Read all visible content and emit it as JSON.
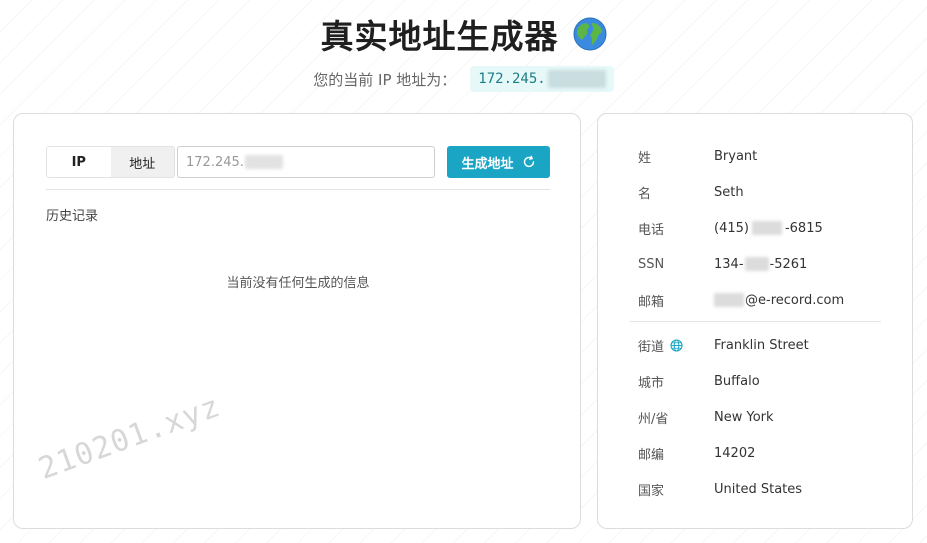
{
  "header": {
    "title": "真实地址生成器",
    "globe_icon": "globe-icon",
    "ip_label": "您的当前 IP 地址为：",
    "ip_prefix": "172.245."
  },
  "form": {
    "tab_ip": "IP",
    "tab_address": "地址",
    "ip_input_value": "172.245.",
    "generate_button": "生成地址",
    "refresh_icon": "refresh-icon",
    "history_label": "历史记录",
    "empty_message": "当前没有任何生成的信息",
    "watermark": "210201.xyz"
  },
  "info": {
    "last_name_label": "姓",
    "last_name": "Bryant",
    "first_name_label": "名",
    "first_name": "Seth",
    "phone_label": "电话",
    "phone_prefix": "(415)",
    "phone_suffix": "-6815",
    "ssn_label": "SSN",
    "ssn_prefix": "134-",
    "ssn_suffix": "-5261",
    "email_label": "邮箱",
    "email_domain": "@e-record.com",
    "street_label": "街道",
    "street": "Franklin Street",
    "city_label": "城市",
    "city": "Buffalo",
    "state_label": "州/省",
    "state": "New York",
    "zip_label": "邮编",
    "zip": "14202",
    "country_label": "国家",
    "country": "United States"
  },
  "colors": {
    "accent": "#19a5c3",
    "ip_chip_bg": "#e6f8f8",
    "ip_chip_text": "#1b7f86"
  }
}
